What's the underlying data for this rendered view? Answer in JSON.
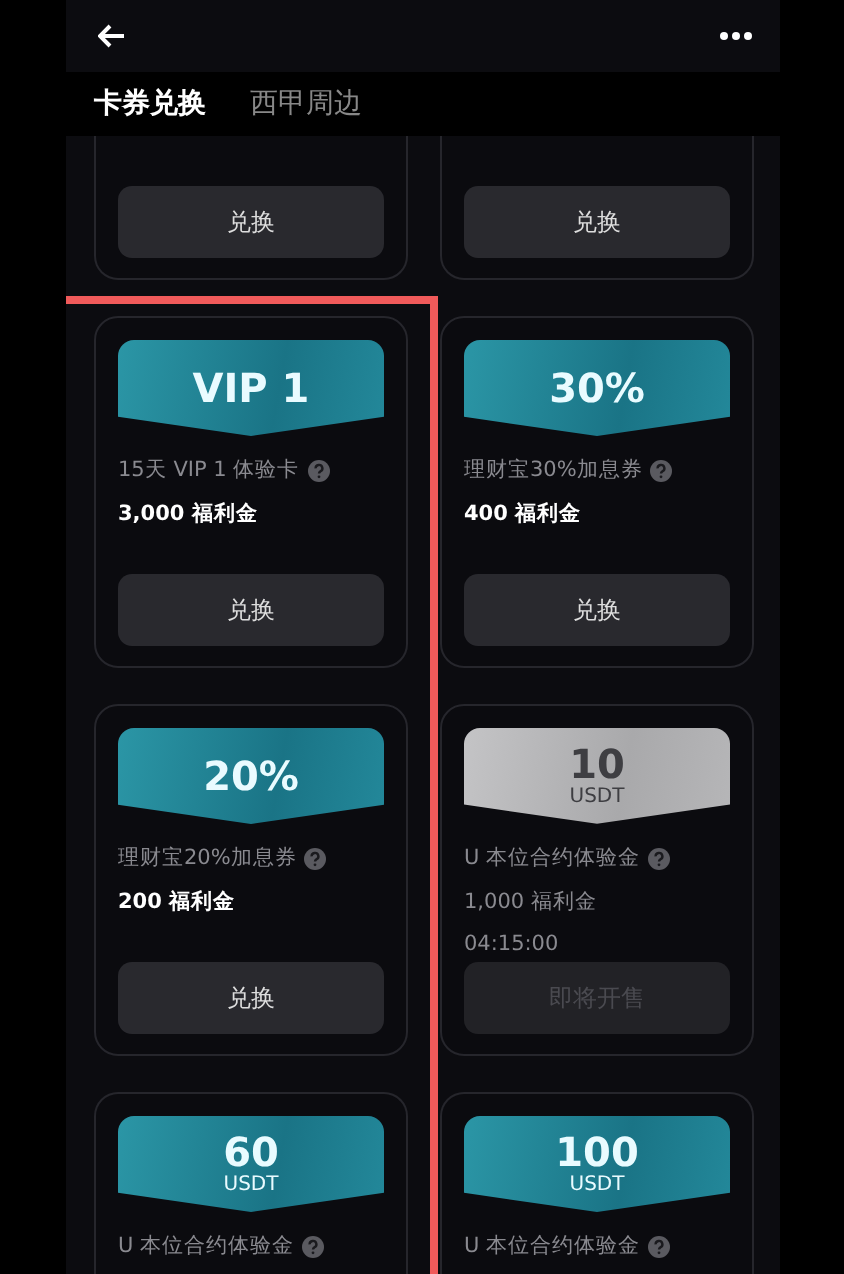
{
  "tabs": [
    {
      "label": "卡券兑换",
      "selected": true
    },
    {
      "label": "西甲周边",
      "selected": false
    }
  ],
  "left_column_highlighted": true,
  "cards": [
    {
      "kind": "cut",
      "button": "兑换",
      "disabled": false
    },
    {
      "kind": "cut",
      "button": "兑换",
      "disabled": false
    },
    {
      "kind": "full",
      "value": "VIP 1",
      "title": "15天 VIP 1 体验卡",
      "amount": "3,000 福利金",
      "button": "兑换",
      "disabled": false
    },
    {
      "kind": "full",
      "value": "30%",
      "title": "理财宝30%加息券",
      "amount": "400 福利金",
      "button": "兑换",
      "disabled": false
    },
    {
      "kind": "full",
      "value": "20%",
      "title": "理财宝20%加息券",
      "amount": "200 福利金",
      "button": "兑换",
      "disabled": false
    },
    {
      "kind": "full",
      "value": "10",
      "unit": "USDT",
      "title": "U 本位合约体验金",
      "amount": "1,000 福利金",
      "timer": "04:15:00",
      "button": "即将开售",
      "disabled": true
    },
    {
      "kind": "bottom",
      "value": "60",
      "unit": "USDT",
      "title": "U 本位合约体验金",
      "disabled": false
    },
    {
      "kind": "bottom",
      "value": "100",
      "unit": "USDT",
      "title": "U 本位合约体验金",
      "disabled": false
    }
  ]
}
